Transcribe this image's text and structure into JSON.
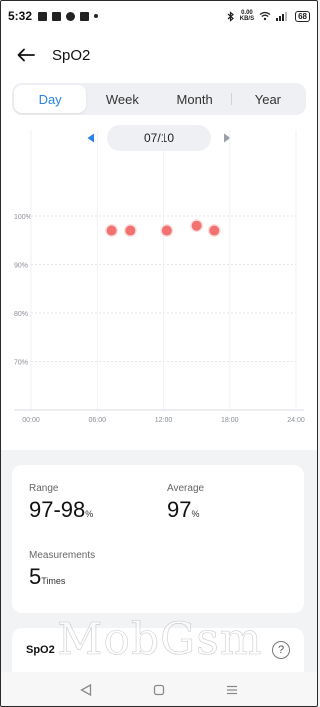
{
  "status_bar": {
    "time": "5:32",
    "net_speed_value": "0.00",
    "net_speed_unit": "KB/S",
    "battery": "68"
  },
  "app_bar": {
    "title": "SpO2"
  },
  "tabs": [
    {
      "label": "Day",
      "active": true
    },
    {
      "label": "Week",
      "active": false
    },
    {
      "label": "Month",
      "active": false
    },
    {
      "label": "Year",
      "active": false
    }
  ],
  "date_selector": {
    "date": "07/10"
  },
  "chart_data": {
    "type": "scatter",
    "x_tick_labels": [
      "00:00",
      "06:00",
      "12:00",
      "18:00",
      "24:00"
    ],
    "y_tick_labels": [
      "100%",
      "90%",
      "80%",
      "70%"
    ],
    "ylim": [
      60,
      100
    ],
    "xlim": [
      0,
      24
    ],
    "points": [
      {
        "x": 7.3,
        "y": 97
      },
      {
        "x": 9.0,
        "y": 97
      },
      {
        "x": 12.3,
        "y": 97
      },
      {
        "x": 15.0,
        "y": 98
      },
      {
        "x": 16.6,
        "y": 97
      }
    ],
    "point_color": "#f27171",
    "grid": true
  },
  "summary": {
    "range_label": "Range",
    "range_value": "97-98",
    "range_unit": "%",
    "average_label": "Average",
    "average_value": "97",
    "average_unit": "%",
    "measurements_label": "Measurements",
    "measurements_value": "5",
    "measurements_unit": "Times"
  },
  "info_card": {
    "title": "SpO2"
  },
  "watermark": "MobGsm",
  "colors": {
    "accent": "#2a83e8",
    "point": "#f27171"
  }
}
